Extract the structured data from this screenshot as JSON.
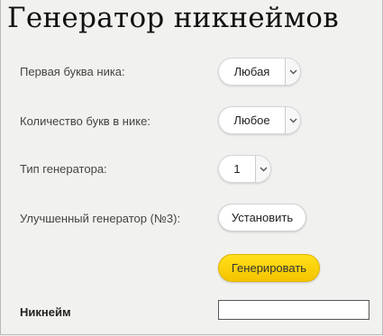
{
  "title": "Генератор никнеймов",
  "fields": {
    "first_letter": {
      "label": "Первая буква ника:",
      "value": "Любая"
    },
    "letter_count": {
      "label": "Количество букв в нике:",
      "value": "Любое"
    },
    "generator_type": {
      "label": "Тип генератора:",
      "value": "1"
    },
    "improved": {
      "label": "Улучшенный генератор (№3):",
      "button": "Установить"
    }
  },
  "generate_button": "Генерировать",
  "nickname": {
    "label": "Никнейм",
    "value": ""
  },
  "colors": {
    "generate_button": "#f7cd00",
    "background": "#f1f1ef"
  },
  "icons": {
    "dropdown": "chevron-down-icon"
  }
}
